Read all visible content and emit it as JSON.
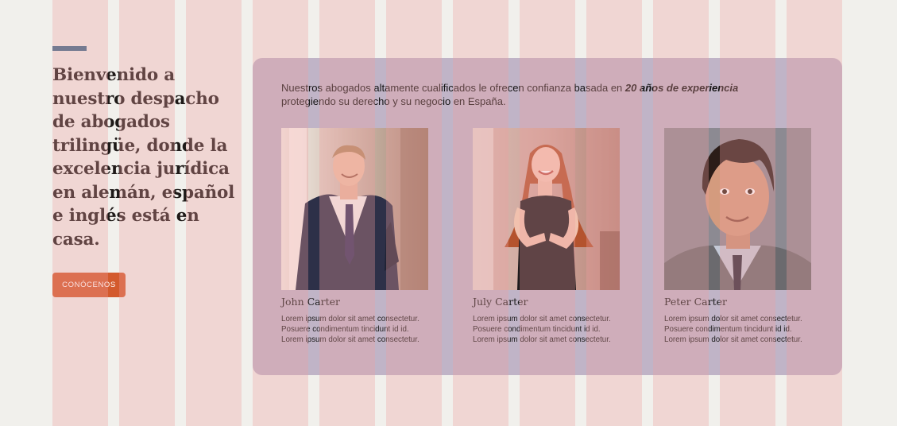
{
  "hero": {
    "headline": "Bienvenido a nuestro despacho de abogados trilingüe, donde la excelencia jurídica en alemán, español e inglés está en casa.",
    "cta_label": "CONÓCENOS",
    "accent_color": "#3c6a8b",
    "cta_color": "#d35a2d"
  },
  "panel": {
    "intro_text": "Nuestros abogados altamente cualificados le ofrecen confianza basada en ",
    "intro_emphasis": "20 años de experiencia",
    "intro_text_2": "protegiendo su derecho y su negocio en España.",
    "background_color": "#c0b4c7"
  },
  "team": [
    {
      "name": "John Carter",
      "desc": [
        "Lorem ipsum dolor sit amet consectetur.",
        "Posuere condimentum tincidunt id id.",
        "Lorem ipsum dolor sit amet consectetur."
      ]
    },
    {
      "name": "July Carter",
      "desc": [
        "Lorem ipsum dolor sit amet consectetur.",
        "Posuere condimentum tincidunt id id.",
        "Lorem ipsum dolor sit amet consectetur."
      ]
    },
    {
      "name": "Peter Carter",
      "desc": [
        "Lorem ipsum dolor sit amet consectetur.",
        "Posuere condimentum tincidunt id id.",
        "Lorem ipsum dolor sit amet consectetur."
      ]
    }
  ]
}
